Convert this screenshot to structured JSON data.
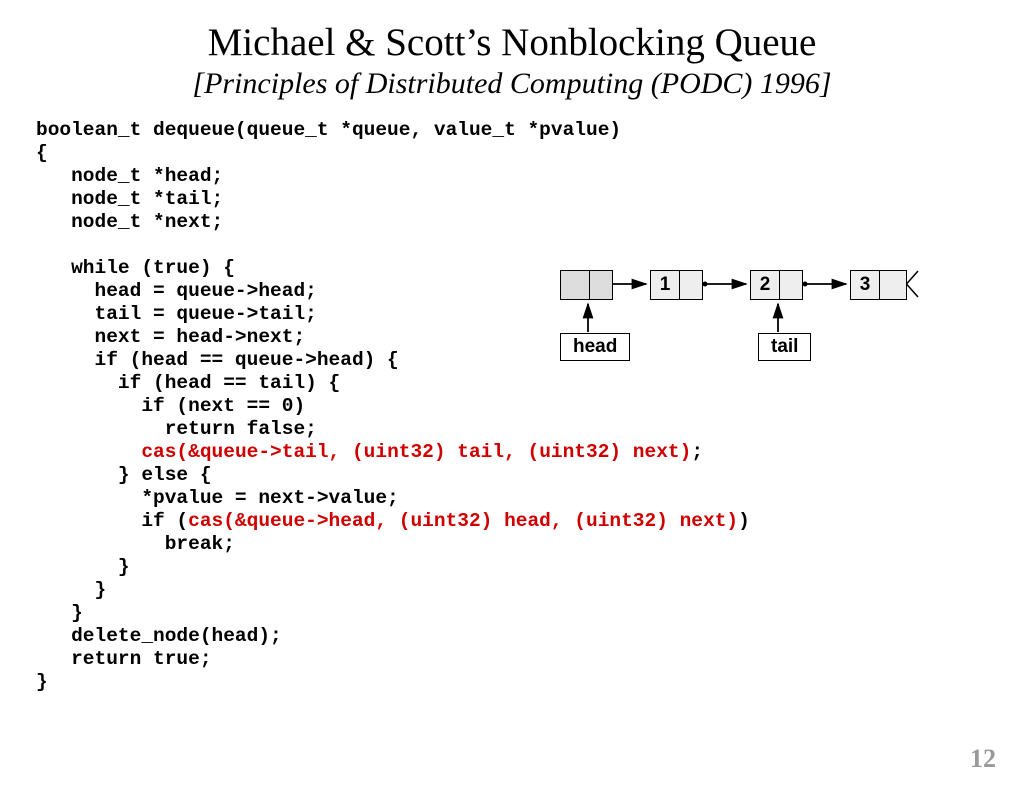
{
  "title": "Michael & Scott’s Nonblocking Queue",
  "subtitle": "[Principles of Distributed Computing (PODC) 1996]",
  "code": {
    "l1": "boolean_t dequeue(queue_t *queue, value_t *pvalue)",
    "l2": "{",
    "l3": "   node_t *head;",
    "l4": "   node_t *tail;",
    "l5": "   node_t *next;",
    "l6": "",
    "l7": "   while (true) {",
    "l8": "     head = queue->head;",
    "l9": "     tail = queue->tail;",
    "l10": "     next = head->next;",
    "l11": "     if (head == queue->head) {",
    "l12": "       if (head == tail) {",
    "l13": "         if (next == 0)",
    "l14": "           return false;",
    "l15a": "         ",
    "l15b": "cas(&queue->tail, (uint32) tail, (uint32) next)",
    "l15c": ";",
    "l16": "       } else {",
    "l17": "         *pvalue = next->value;",
    "l18a": "         if (",
    "l18b": "cas(&queue->head, (uint32) head, (uint32) next)",
    "l18c": ")",
    "l19": "           break;",
    "l20": "       }",
    "l21": "     }",
    "l22": "   }",
    "l23": "   delete_node(head);",
    "l24": "   return true;",
    "l25": "}"
  },
  "diagram": {
    "nodes": [
      "",
      "1",
      "2",
      "3"
    ],
    "labels": {
      "head": "head",
      "tail": "tail"
    }
  },
  "page_number": "12"
}
